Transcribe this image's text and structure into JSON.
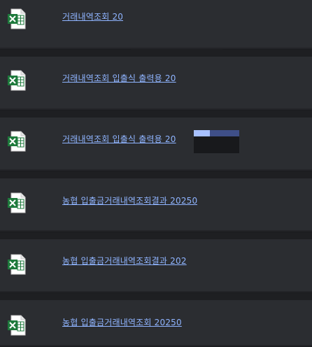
{
  "files": [
    {
      "name": "거래내역조회 20",
      "icon": "excel-file-icon"
    },
    {
      "name": "거래내역조회 입출식 출력용 20",
      "icon": "excel-file-icon"
    },
    {
      "name": "거래내역조회 입출식 출력용 20",
      "icon": "excel-file-icon"
    },
    {
      "name": "농협 입출금거래내역조회결과 20250",
      "icon": "excel-file-icon"
    },
    {
      "name": "농협 입출금거래내역조회결과 202",
      "icon": "excel-file-icon"
    },
    {
      "name": "농협 입출금거래내역조회 20250",
      "icon": "excel-file-icon"
    }
  ],
  "colors": {
    "link": "#8fb4ff",
    "row_bg": "#2b2d31",
    "page_bg": "#1e1f22",
    "excel_green": "#1e7a3c"
  }
}
